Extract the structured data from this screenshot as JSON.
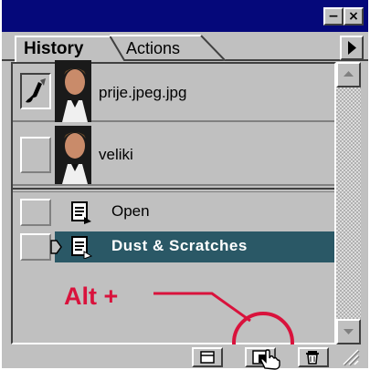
{
  "window": {
    "minimize_glyph": "−",
    "close_glyph": "×",
    "title_color": "#05087a"
  },
  "tabs": [
    {
      "label": "History",
      "active": true
    },
    {
      "label": "Actions",
      "active": false
    }
  ],
  "snapshots": [
    {
      "label": "prije.jpeg.jpg",
      "has_brush": true
    },
    {
      "label": "veliki",
      "has_brush": false
    }
  ],
  "steps": [
    {
      "label": "Open",
      "selected": false
    },
    {
      "label": "Dust & Scratches",
      "selected": true
    }
  ],
  "colors": {
    "selected_row": "#2a5866",
    "annotation": "#d9123c",
    "panel": "#c0c0c0"
  },
  "annotation": {
    "text": "Alt +"
  },
  "bottom_buttons": [
    "new-document-icon",
    "new-snapshot-icon",
    "trash-icon"
  ]
}
